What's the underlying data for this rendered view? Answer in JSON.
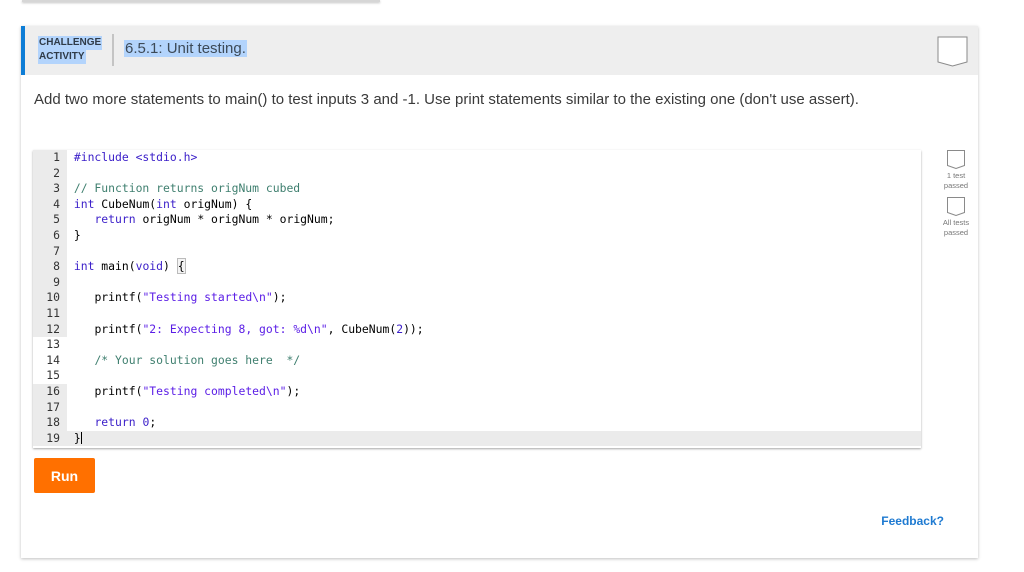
{
  "activity": {
    "type_label_line1": "CHALLENGE",
    "type_label_line2": "ACTIVITY",
    "title": "6.5.1: Unit testing.",
    "completion_icon": "completion-badge-icon"
  },
  "instructions": "Add two more statements to main() to test inputs 3 and -1. Use print statements similar to the existing one (don't use assert).",
  "editor": {
    "lines": [
      {
        "n": "1"
      },
      {
        "n": "2"
      },
      {
        "n": "3"
      },
      {
        "n": "4"
      },
      {
        "n": "5"
      },
      {
        "n": "6"
      },
      {
        "n": "7"
      },
      {
        "n": "8"
      },
      {
        "n": "9"
      },
      {
        "n": "10"
      },
      {
        "n": "11"
      },
      {
        "n": "12"
      },
      {
        "n": "13"
      },
      {
        "n": "14"
      },
      {
        "n": "15"
      },
      {
        "n": "16"
      },
      {
        "n": "17"
      },
      {
        "n": "18"
      },
      {
        "n": "19"
      }
    ],
    "code": {
      "l1": "#include <stdio.h>",
      "l3": "// Function returns origNum cubed",
      "l4_kw1": "int",
      "l4_a": " CubeNum(",
      "l4_kw2": "int",
      "l4_b": " origNum) {",
      "l5_kw": "return",
      "l5_rest": " origNum * origNum * origNum;",
      "l6": "}",
      "l8_kw": "int",
      "l8_a": " main(",
      "l8_kw2": "void",
      "l8_b": ") ",
      "l8_brace": "{",
      "l10_a": "printf(",
      "l10_str": "\"Testing started\\n\"",
      "l10_b": ");",
      "l12_a": "printf(",
      "l12_str": "\"2: Expecting 8, got: %d\\n\"",
      "l12_b": ", CubeNum(",
      "l12_num": "2",
      "l12_c": "));",
      "l14": "/* Your solution goes here  */",
      "l16_a": "printf(",
      "l16_str": "\"Testing completed\\n\"",
      "l16_b": ");",
      "l18_kw": "return",
      "l18_num": "0",
      "l18_b": ";",
      "l19": "}"
    }
  },
  "status": [
    {
      "label_line1": "1 test",
      "label_line2": "passed"
    },
    {
      "label_line1": "All tests",
      "label_line2": "passed"
    }
  ],
  "run_label": "Run",
  "feedback_label": "Feedback?",
  "colors": {
    "accent": "#0d7dd6",
    "run_button": "#ff7000",
    "feedback_link": "#1e7ad1"
  }
}
